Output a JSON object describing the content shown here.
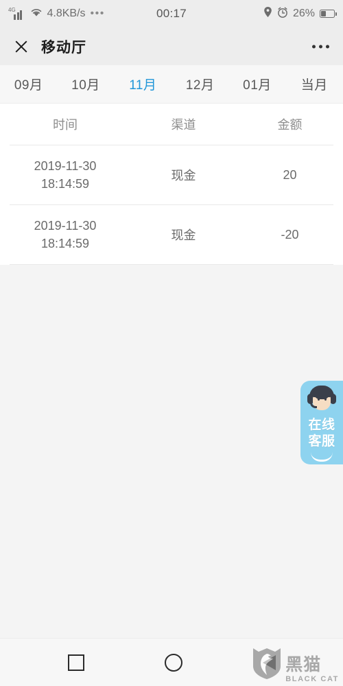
{
  "status_bar": {
    "network_type": "4G",
    "speed": "4.8KB/s",
    "overflow": "•••",
    "time": "00:17",
    "battery_percent": "26%",
    "icons": [
      "signal-icon",
      "wifi-icon",
      "location-icon",
      "alarm-icon",
      "battery-icon"
    ]
  },
  "header": {
    "close_label": "✕",
    "title": "移动厅",
    "more_label": "•••"
  },
  "tabs": [
    {
      "label": "09月",
      "active": false
    },
    {
      "label": "10月",
      "active": false
    },
    {
      "label": "11月",
      "active": true
    },
    {
      "label": "12月",
      "active": false
    },
    {
      "label": "01月",
      "active": false
    },
    {
      "label": "当月",
      "active": false
    }
  ],
  "table": {
    "columns": [
      "时间",
      "渠道",
      "金额"
    ],
    "rows": [
      {
        "date": "2019-11-30",
        "time": "18:14:59",
        "channel": "现金",
        "amount": "20"
      },
      {
        "date": "2019-11-30",
        "time": "18:14:59",
        "channel": "现金",
        "amount": "-20"
      }
    ]
  },
  "customer_service": {
    "line1": "在线",
    "line2": "客服",
    "bg_color": "#8ed3ef"
  },
  "nav_bar": {
    "recents": "recents-square-icon",
    "home": "home-circle-icon",
    "back": "back-triangle-icon"
  },
  "watermark": {
    "cn": "黑猫",
    "en": "BLACK CAT"
  },
  "colors": {
    "accent": "#2196d8",
    "header_bg": "#ededed",
    "page_bg": "#f4f4f4",
    "card_bg": "#ffffff",
    "text": "#6a6a6a"
  }
}
